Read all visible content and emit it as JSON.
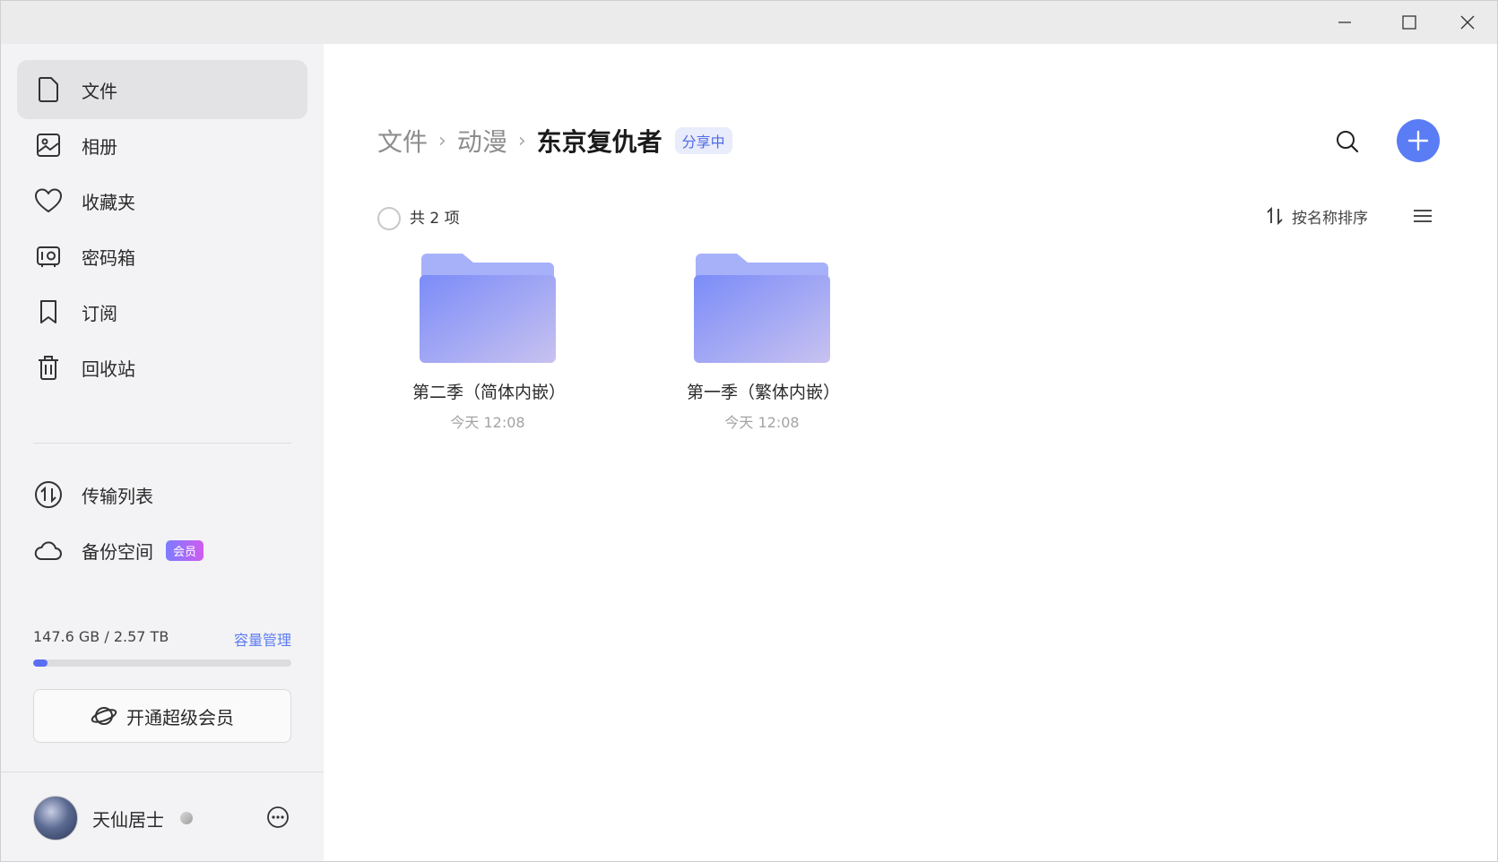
{
  "window": {
    "minimize_label": "minimize",
    "maximize_label": "maximize",
    "close_label": "close"
  },
  "sidebar": {
    "items": [
      {
        "label": "文件",
        "icon": "file-icon"
      },
      {
        "label": "相册",
        "icon": "photo-album-icon"
      },
      {
        "label": "收藏夹",
        "icon": "heart-icon"
      },
      {
        "label": "密码箱",
        "icon": "safe-box-icon"
      },
      {
        "label": "订阅",
        "icon": "bookmark-icon"
      },
      {
        "label": "回收站",
        "icon": "trash-icon"
      }
    ],
    "items2": [
      {
        "label": "传输列表",
        "icon": "transfer-icon"
      },
      {
        "label": "备份空间",
        "icon": "cloud-icon",
        "tag": "会员"
      }
    ],
    "storage": {
      "text": "147.6 GB / 2.57 TB",
      "manage_label": "容量管理",
      "used_fraction": 0.056
    },
    "vip_button_label": "开通超级会员",
    "user": {
      "name": "天仙居士"
    }
  },
  "main": {
    "breadcrumb": [
      "文件",
      "动漫"
    ],
    "current_folder": "东京复仇者",
    "share_badge": "分享中",
    "count_text": "共 2 项",
    "sort_label": "按名称排序",
    "files": [
      {
        "name": "第二季（简体内嵌）",
        "time": "今天 12:08"
      },
      {
        "name": "第一季（繁体内嵌）",
        "time": "今天 12:08"
      }
    ]
  },
  "colors": {
    "accent": "#5a7cf5",
    "share_badge_bg": "#e8ecfb",
    "folder_start": "#7b8cf8",
    "folder_end": "#c8c2f0"
  }
}
